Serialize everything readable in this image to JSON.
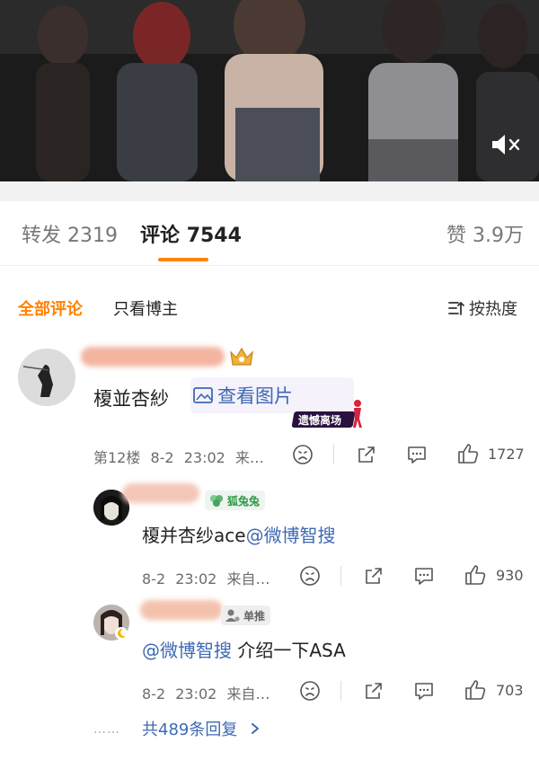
{
  "tabs": [
    {
      "label": "转发",
      "count": "2319"
    },
    {
      "label": "评论",
      "count": "7544"
    },
    {
      "label": "赞",
      "count": "3.9万"
    }
  ],
  "filter": {
    "all": "全部评论",
    "host_only": "只看博主",
    "sort": "按热度"
  },
  "comment": {
    "text": "榎並杏紗",
    "view_image": "查看图片",
    "sticker": "遗憾离场",
    "floor": "第12楼",
    "time": "8-2",
    "clock": "23:02",
    "source": "来…",
    "likes": "1727"
  },
  "replies": [
    {
      "badge": "狐兔兔",
      "text_prefix": "榎并杏纱ace",
      "mention": "@微博智搜",
      "time": "8-2",
      "clock": "23:02",
      "source": "来自…",
      "likes": "930"
    },
    {
      "badge": "单推",
      "mention": "@微博智搜",
      "text_suffix": " 介绍一下ASA",
      "time": "8-2",
      "clock": "23:02",
      "source": "来自…",
      "likes": "703"
    }
  ],
  "more_replies": "共489条回复",
  "colors": {
    "accent": "#ff8200",
    "link": "#3d69b3",
    "badge_green": "#2f9a48"
  }
}
